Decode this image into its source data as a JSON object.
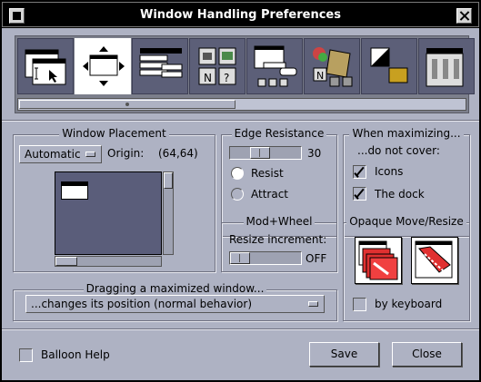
{
  "window": {
    "title": "Window Handling Preferences"
  },
  "icon_strip": {
    "items": [
      {
        "icon": "focus-icon",
        "selected": false
      },
      {
        "icon": "window-handling-icon",
        "selected": true
      },
      {
        "icon": "menu-icon",
        "selected": false
      },
      {
        "icon": "icon-placement-icon",
        "selected": false
      },
      {
        "icon": "keyboard-icon",
        "selected": false
      },
      {
        "icon": "workspace-icon",
        "selected": false
      },
      {
        "icon": "appearance-icon",
        "selected": false
      },
      {
        "icon": "config-icon",
        "selected": false
      }
    ]
  },
  "placement": {
    "title": "Window Placement",
    "mode": "Automatic",
    "origin_label": "Origin:",
    "origin_value": "(64,64)"
  },
  "edge": {
    "title": "Edge Resistance",
    "value": "30",
    "resist_label": "Resist",
    "attract_label": "Attract",
    "selected": "resist"
  },
  "maximize": {
    "title": "When maximizing...",
    "subtitle": "...do not cover:",
    "icons_label": "Icons",
    "dock_label": "The dock",
    "icons_checked": true,
    "dock_checked": true
  },
  "modwheel": {
    "title": "Mod+Wheel",
    "increment_label": "Resize increment:",
    "value": "OFF"
  },
  "opaque": {
    "title": "Opaque Move/Resize",
    "keyboard_label": "by keyboard",
    "keyboard_checked": false
  },
  "dragging": {
    "title": "Dragging a maximized window...",
    "option": "...changes its position (normal behavior)"
  },
  "footer": {
    "balloon_label": "Balloon Help",
    "save_label": "Save",
    "close_label": "Close"
  }
}
